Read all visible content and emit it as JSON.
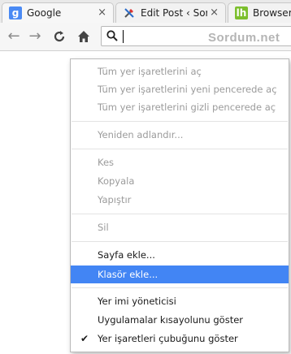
{
  "tabs": [
    {
      "title": "Google",
      "favicon": "g-favicon",
      "close": "×"
    },
    {
      "title": "Edit Post ‹ Sordu",
      "favicon": "wordpress-favicon",
      "close": "×"
    },
    {
      "title": "Browser Sp",
      "favicon": "lh-favicon"
    }
  ],
  "toolbar": {
    "back": "←",
    "forward": "→",
    "reload": "C",
    "home": "⌂",
    "omnibox_value": ""
  },
  "watermark": "Sordum.net",
  "menu": {
    "open_all": "Tüm yer işaretlerini aç",
    "open_all_new_window": "Tüm yer işaretlerini yeni pencerede aç",
    "open_all_incognito": "Tüm yer işaretlerini gizli pencerede aç",
    "rename": "Yeniden adlandır...",
    "cut": "Kes",
    "copy": "Kopyala",
    "paste": "Yapıştır",
    "delete": "Sil",
    "add_page": "Sayfa ekle...",
    "add_folder": "Klasör ekle...",
    "bookmark_manager": "Yer imi yöneticisi",
    "show_apps_shortcut": "Uygulamalar kısayolunu göster",
    "show_bookmarks_bar": "Yer işaretleri çubuğunu göster",
    "check_mark": "✔"
  },
  "colors": {
    "highlight": "#4285f4",
    "disabled_text": "#9b9b9b",
    "enabled_text": "#1a1a1a"
  }
}
